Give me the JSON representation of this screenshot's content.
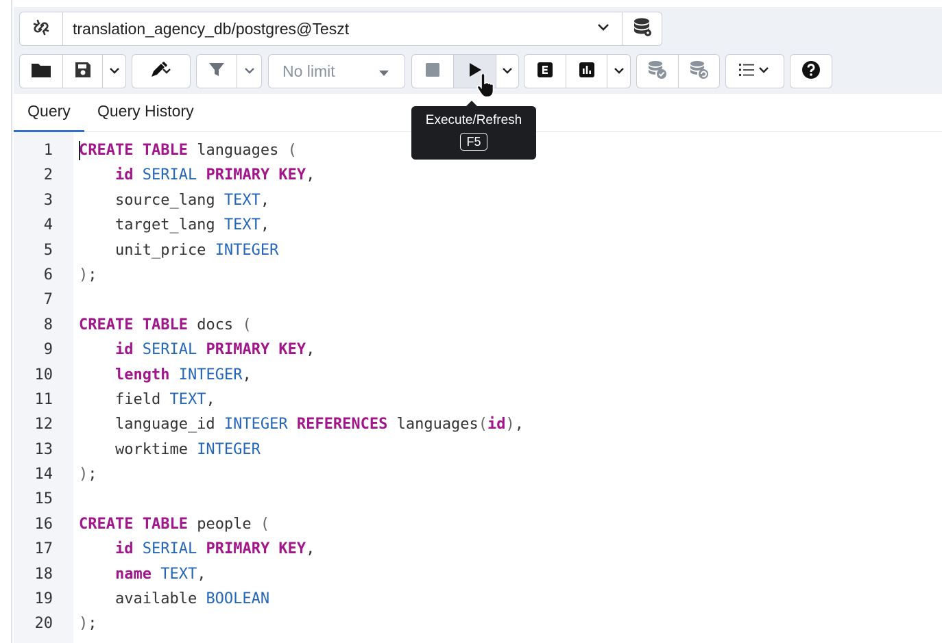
{
  "connection": {
    "title": "translation_agency_db/postgres@Teszt",
    "link_icon": "unlink-icon",
    "dropdown_icon": "chevron-down-icon",
    "db_icon": "database-icon"
  },
  "toolbar": {
    "limit_label": "No limit",
    "icons": [
      "folder-icon",
      "save-icon",
      "chevron-down-icon",
      "pen-icon",
      "chevron-down-icon",
      "filter-icon",
      "chevron-down-icon",
      "stop-icon",
      "play-icon",
      "chevron-down-icon",
      "explain-icon",
      "explain-analyze-icon",
      "chevron-down-icon",
      "commit-icon",
      "rollback-icon",
      "macros-icon",
      "help-icon"
    ]
  },
  "tabs": [
    {
      "label": "Query",
      "active": true
    },
    {
      "label": "Query History",
      "active": false
    }
  ],
  "tooltip": {
    "title": "Execute/Refresh",
    "shortcut": "F5"
  },
  "colors": {
    "keyword": "#a2168c",
    "type": "#2466b8",
    "tab_accent": "#326fcb",
    "tooltip_bg": "#1c1e21"
  },
  "editor": {
    "lines": [
      {
        "n": "1",
        "tokens": [
          [
            "kw",
            "CREATE TABLE"
          ],
          [
            "t",
            " languages "
          ],
          [
            "pn",
            "("
          ]
        ]
      },
      {
        "n": "2",
        "tokens": [
          [
            "t",
            "    "
          ],
          [
            "kw",
            "id"
          ],
          [
            "t",
            " "
          ],
          [
            "ty",
            "SERIAL"
          ],
          [
            "t",
            " "
          ],
          [
            "kw",
            "PRIMARY KEY"
          ],
          [
            "t",
            ","
          ]
        ]
      },
      {
        "n": "3",
        "tokens": [
          [
            "t",
            "    source_lang "
          ],
          [
            "ty",
            "TEXT"
          ],
          [
            "t",
            ","
          ]
        ]
      },
      {
        "n": "4",
        "tokens": [
          [
            "t",
            "    target_lang "
          ],
          [
            "ty",
            "TEXT"
          ],
          [
            "t",
            ","
          ]
        ]
      },
      {
        "n": "5",
        "tokens": [
          [
            "t",
            "    unit_price "
          ],
          [
            "ty",
            "INTEGER"
          ]
        ]
      },
      {
        "n": "6",
        "tokens": [
          [
            "pn",
            ")"
          ],
          [
            "t",
            ";"
          ]
        ]
      },
      {
        "n": "7",
        "tokens": []
      },
      {
        "n": "8",
        "tokens": [
          [
            "kw",
            "CREATE TABLE"
          ],
          [
            "t",
            " docs "
          ],
          [
            "pn",
            "("
          ]
        ]
      },
      {
        "n": "9",
        "tokens": [
          [
            "t",
            "    "
          ],
          [
            "kw",
            "id"
          ],
          [
            "t",
            " "
          ],
          [
            "ty",
            "SERIAL"
          ],
          [
            "t",
            " "
          ],
          [
            "kw",
            "PRIMARY KEY"
          ],
          [
            "t",
            ","
          ]
        ]
      },
      {
        "n": "10",
        "tokens": [
          [
            "t",
            "    "
          ],
          [
            "kw",
            "length"
          ],
          [
            "t",
            " "
          ],
          [
            "ty",
            "INTEGER"
          ],
          [
            "t",
            ","
          ]
        ]
      },
      {
        "n": "11",
        "tokens": [
          [
            "t",
            "    field "
          ],
          [
            "ty",
            "TEXT"
          ],
          [
            "t",
            ","
          ]
        ]
      },
      {
        "n": "12",
        "tokens": [
          [
            "t",
            "    language_id "
          ],
          [
            "ty",
            "INTEGER"
          ],
          [
            "t",
            " "
          ],
          [
            "kw",
            "REFERENCES"
          ],
          [
            "t",
            " languages"
          ],
          [
            "pn",
            "("
          ],
          [
            "kw",
            "id"
          ],
          [
            "pn",
            ")"
          ],
          [
            "t",
            ","
          ]
        ]
      },
      {
        "n": "13",
        "tokens": [
          [
            "t",
            "    worktime "
          ],
          [
            "ty",
            "INTEGER"
          ]
        ]
      },
      {
        "n": "14",
        "tokens": [
          [
            "pn",
            ")"
          ],
          [
            "t",
            ";"
          ]
        ]
      },
      {
        "n": "15",
        "tokens": []
      },
      {
        "n": "16",
        "tokens": [
          [
            "kw",
            "CREATE TABLE"
          ],
          [
            "t",
            " people "
          ],
          [
            "pn",
            "("
          ]
        ]
      },
      {
        "n": "17",
        "tokens": [
          [
            "t",
            "    "
          ],
          [
            "kw",
            "id"
          ],
          [
            "t",
            " "
          ],
          [
            "ty",
            "SERIAL"
          ],
          [
            "t",
            " "
          ],
          [
            "kw",
            "PRIMARY KEY"
          ],
          [
            "t",
            ","
          ]
        ]
      },
      {
        "n": "18",
        "tokens": [
          [
            "t",
            "    "
          ],
          [
            "kw",
            "name"
          ],
          [
            "t",
            " "
          ],
          [
            "ty",
            "TEXT"
          ],
          [
            "t",
            ","
          ]
        ]
      },
      {
        "n": "19",
        "tokens": [
          [
            "t",
            "    available "
          ],
          [
            "ty",
            "BOOLEAN"
          ]
        ]
      },
      {
        "n": "20",
        "tokens": [
          [
            "pn",
            ")"
          ],
          [
            "t",
            ";"
          ]
        ]
      }
    ]
  }
}
